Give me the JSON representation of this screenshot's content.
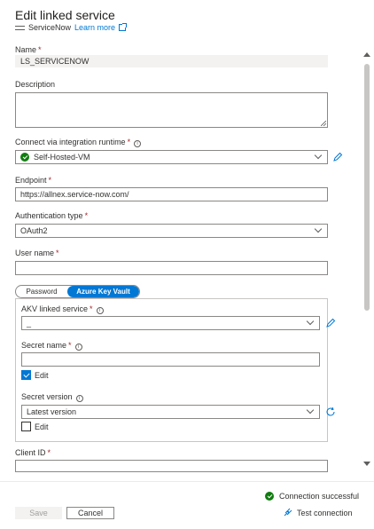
{
  "header": {
    "title": "Edit linked service",
    "service_name": "ServiceNow",
    "learn_more": "Learn more"
  },
  "form": {
    "name": {
      "label": "Name",
      "value": "LS_SERVICENOW"
    },
    "description": {
      "label": "Description",
      "value": ""
    },
    "runtime": {
      "label": "Connect via integration runtime",
      "value": "Self-Hosted-VM"
    },
    "endpoint": {
      "label": "Endpoint",
      "value": "https://allnex.service-now.com/"
    },
    "auth_type": {
      "label": "Authentication type",
      "value": "OAuth2"
    },
    "user_name": {
      "label": "User name",
      "value": ""
    },
    "password_toggle": {
      "password": "Password",
      "akv": "Azure Key Vault",
      "selected": "Azure Key Vault"
    },
    "akv_linked_service": {
      "label": "AKV linked service",
      "value": "_"
    },
    "secret_name": {
      "label": "Secret name",
      "value": "",
      "edit_label": "Edit",
      "edit_checked": true
    },
    "secret_version": {
      "label": "Secret version",
      "value": "Latest version",
      "edit_label": "Edit",
      "edit_checked": false
    },
    "client_id": {
      "label": "Client ID",
      "value": ""
    }
  },
  "footer": {
    "status": "Connection successful",
    "test_connection": "Test connection",
    "save": "Save",
    "cancel": "Cancel"
  },
  "colors": {
    "accent": "#0078d4",
    "success": "#107c10",
    "required": "#a4262c"
  }
}
